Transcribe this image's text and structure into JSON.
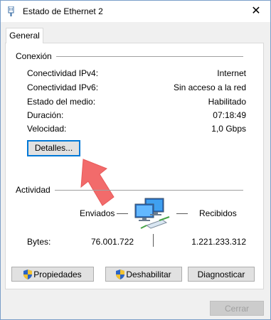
{
  "window": {
    "title": "Estado de Ethernet 2"
  },
  "tabs": [
    {
      "label": "General"
    }
  ],
  "connection": {
    "group_label": "Conexión",
    "rows": [
      {
        "label": "Conectividad IPv4:",
        "value": "Internet"
      },
      {
        "label": "Conectividad IPv6:",
        "value": "Sin acceso a la red"
      },
      {
        "label": "Estado del medio:",
        "value": "Habilitado"
      },
      {
        "label": "Duración:",
        "value": "07:18:49"
      },
      {
        "label": "Velocidad:",
        "value": "1,0 Gbps"
      }
    ],
    "details_button": "Detalles..."
  },
  "activity": {
    "group_label": "Actividad",
    "sent_label": "Enviados",
    "received_label": "Recibidos",
    "bytes_label": "Bytes:",
    "bytes_sent": "76.001.722",
    "bytes_received": "1.221.233.312"
  },
  "buttons": {
    "properties": "Propiedades",
    "disable": "Deshabilitar",
    "diagnose": "Diagnosticar",
    "close": "Cerrar"
  },
  "colors": {
    "annotation_arrow": "#f26b6b",
    "focus_border": "#0078d7"
  },
  "icons": [
    "network-adapter-icon",
    "close-icon",
    "network-computers-icon",
    "uac-shield-icon"
  ]
}
